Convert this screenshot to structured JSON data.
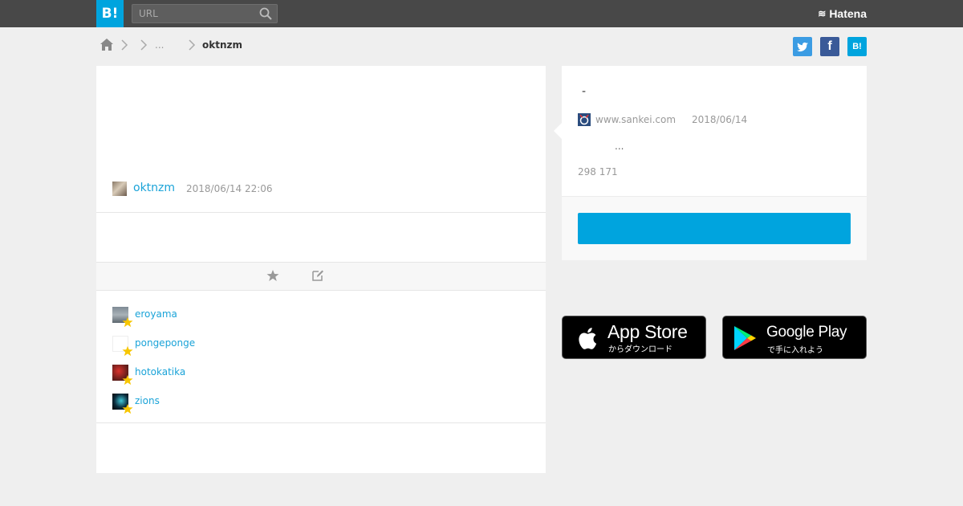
{
  "header": {
    "logo_text": "B!",
    "search": {
      "placeholder": "URL",
      "value": ""
    },
    "brand": "Hatena",
    "brand_mark": "≋"
  },
  "breadcrumb": {
    "ellipsis": "...",
    "current": "oktnzm"
  },
  "share": {
    "facebook_label": "f",
    "hatena_label": "B!"
  },
  "comment": {
    "username": "oktnzm",
    "timestamp": "2018/06/14 22:06"
  },
  "starrers": [
    {
      "name": "eroyama"
    },
    {
      "name": "pongeponge"
    },
    {
      "name": "hotokatika"
    },
    {
      "name": "zions"
    }
  ],
  "entry": {
    "title": "-",
    "domain": "www.sankei.com",
    "date": "2018/06/14",
    "snippet": "...",
    "counts": "298 171",
    "button_label": ""
  },
  "app_badges": {
    "appstore": {
      "title": "App Store",
      "subtitle": "からダウンロード"
    },
    "googleplay": {
      "title": "Google Play",
      "subtitle": "で手に入れよう"
    }
  },
  "colors": {
    "accent": "#00a4de",
    "topbar": "#484848",
    "link": "#1aa3d8",
    "star": "#f7c600"
  },
  "icons": {
    "search": "search-icon",
    "home": "home-icon",
    "star": "star-icon",
    "edit": "edit-icon"
  }
}
